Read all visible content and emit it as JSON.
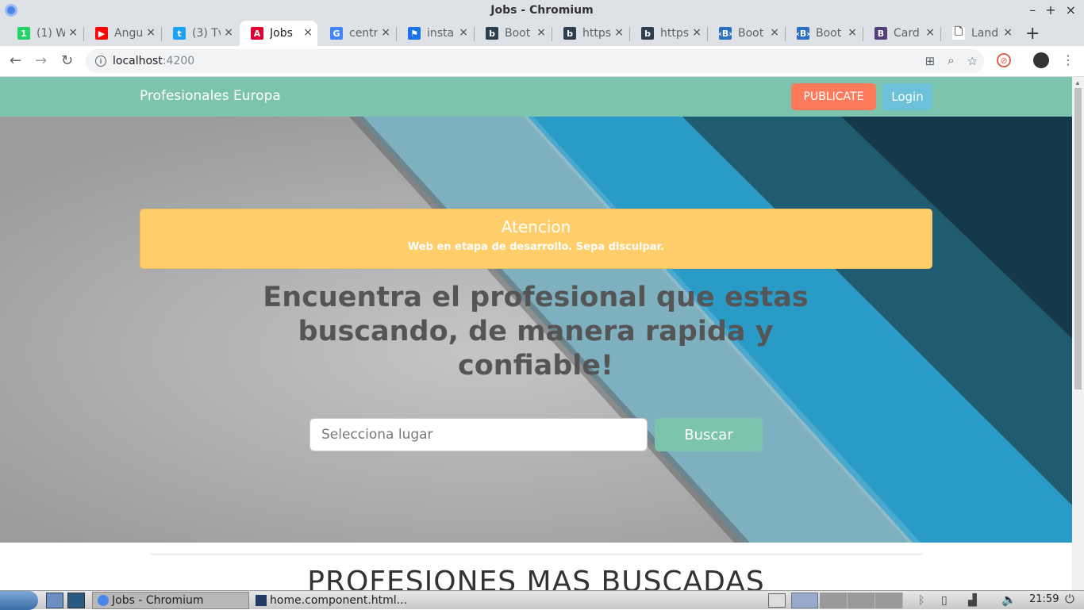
{
  "window": {
    "title": "Jobs - Chromium",
    "controls": [
      "–",
      "+",
      "×"
    ]
  },
  "tabs": [
    {
      "label": "(1) W",
      "favicon": "whatsapp-icon",
      "color": "#25d366",
      "glyph": "1"
    },
    {
      "label": "Angu",
      "favicon": "youtube-icon",
      "color": "#ff0000",
      "glyph": "▶"
    },
    {
      "label": "(3) Tv",
      "favicon": "twitter-icon",
      "color": "#1da1f2",
      "glyph": "t"
    },
    {
      "label": "Jobs",
      "favicon": "angular-icon",
      "color": "#dd0031",
      "glyph": "A",
      "active": true
    },
    {
      "label": "centr",
      "favicon": "google-icon",
      "color": "#4285f4",
      "glyph": "G"
    },
    {
      "label": "insta",
      "favicon": "flag-icon",
      "color": "#1a73e8",
      "glyph": "⚑"
    },
    {
      "label": "Boot",
      "favicon": "bootsnipp-icon",
      "color": "#2c3e50",
      "glyph": "b"
    },
    {
      "label": "https",
      "favicon": "bootsnipp-icon",
      "color": "#2c3e50",
      "glyph": "b"
    },
    {
      "label": "https",
      "favicon": "bootsnipp-icon",
      "color": "#2c3e50",
      "glyph": "b"
    },
    {
      "label": "Boot",
      "favicon": "bootstrap-mdb-icon",
      "color": "#2e70c0",
      "glyph": "‹B›"
    },
    {
      "label": "Boot",
      "favicon": "bootstrap-mdb-icon",
      "color": "#2e70c0",
      "glyph": "‹B›"
    },
    {
      "label": "Card",
      "favicon": "bootstrap-icon",
      "color": "#563d7c",
      "glyph": "B"
    },
    {
      "label": "Land",
      "favicon": "document-icon",
      "color": "#ffffff",
      "glyph": "🗋"
    }
  ],
  "address": {
    "host": "localhost",
    "port": ":4200"
  },
  "site": {
    "brand": "Profesionales Europa",
    "publicate": "PUBLICATE",
    "login": "Login",
    "alert_title": "Atencion",
    "alert_text": "Web en etapa de desarrollo. Sepa disculpar.",
    "headline": "Encuentra el profesional que estas buscando, de manera rapida y confiable!",
    "search_placeholder": "Selecciona lugar",
    "search_button": "Buscar",
    "section_title": "PROFESIONES MAS BUSCADAS"
  },
  "colors": {
    "navbar": "#7dc4ae",
    "publicate": "#fd7b5b",
    "login": "#6cc0d8",
    "alert": "#ffce6a"
  },
  "taskbar": {
    "items": [
      "Jobs - Chromium",
      "home.component.html..."
    ],
    "clock": "21:59"
  }
}
